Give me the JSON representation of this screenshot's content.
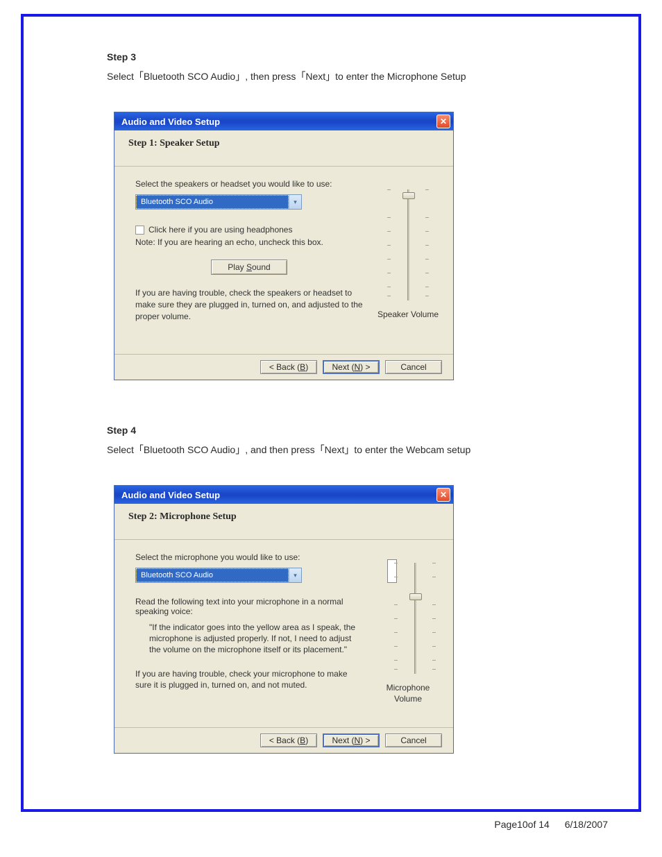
{
  "step3": {
    "heading": "Step 3",
    "text": "Select「Bluetooth SCO Audio」, then press「Next」to enter the Microphone Setup"
  },
  "dialog1": {
    "title": "Audio and Video Setup",
    "header": "Step 1: Speaker Setup",
    "prompt": "Select the speakers or headset you would like to use:",
    "combo_value": "Bluetooth SCO Audio",
    "checkbox_label": "Click here if you are using headphones",
    "note": "Note: If you are hearing an echo, uncheck this box.",
    "play_prefix": "Play ",
    "play_underline": "S",
    "play_suffix": "ound",
    "trouble": "If you are having trouble, check the speakers or headset to make sure they are plugged in, turned on, and adjusted to the proper volume.",
    "volume_label": "Speaker Volume",
    "back_prefix": "<  Back  (",
    "back_u": "B",
    "back_suffix": ")",
    "next_prefix": "Next  (",
    "next_u": "N",
    "next_suffix": ") >",
    "cancel": "Cancel"
  },
  "step4": {
    "heading": "Step 4",
    "text": "Select「Bluetooth SCO Audio」, and then press「Next」to enter the Webcam setup"
  },
  "dialog2": {
    "title": "Audio and Video Setup",
    "header": "Step 2: Microphone Setup",
    "prompt": "Select the microphone you would like to use:",
    "combo_value": "Bluetooth SCO Audio",
    "instruct": "Read the following text into your microphone in a normal speaking voice:",
    "quote": "\"If the indicator goes into the yellow area as I speak, the microphone is adjusted properly.  If not, I need to adjust the volume on the microphone itself or its placement.\"",
    "trouble": "If you are having trouble, check your microphone to make sure it is plugged in, turned on, and not muted.",
    "volume_label": "Microphone Volume",
    "back_prefix": "<  Back  (",
    "back_u": "B",
    "back_suffix": ")",
    "next_prefix": "Next  (",
    "next_u": "N",
    "next_suffix": ") >",
    "cancel": "Cancel"
  },
  "footer": {
    "page": "Page10of 14",
    "date": "6/18/2007"
  }
}
